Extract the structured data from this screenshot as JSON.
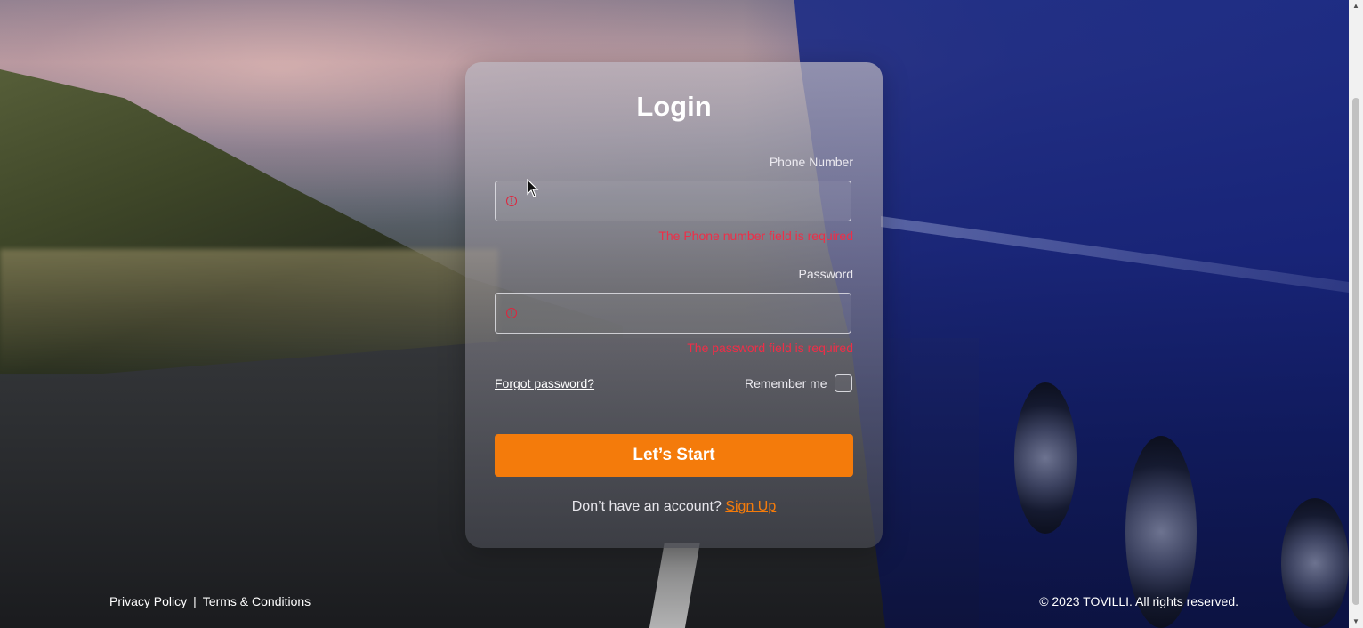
{
  "login": {
    "title": "Login",
    "phone": {
      "label": "Phone Number",
      "value": "",
      "error": "The Phone number field is required"
    },
    "password": {
      "label": "Password",
      "value": "",
      "error": "The password field is required"
    },
    "forgot_label": "Forgot password?",
    "remember_label": "Remember me",
    "remember_checked": false,
    "submit_label": "Let’s Start",
    "signup_prompt": "Don’t have an account?",
    "signup_link": "Sign Up"
  },
  "footer": {
    "privacy": "Privacy Policy",
    "separator": "|",
    "terms": "Terms & Conditions",
    "copyright": "© 2023 TOVILLI. All rights reserved."
  },
  "colors": {
    "accent": "#f47b0b",
    "error": "#ee2e48"
  },
  "icons": {
    "field_error": "alert-circle-icon",
    "cursor": "mouse-pointer-icon"
  }
}
